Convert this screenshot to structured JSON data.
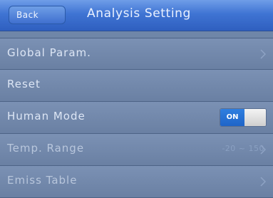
{
  "header": {
    "back_label": "Back",
    "title": "Analysis Setting"
  },
  "rows": [
    {
      "label": "Global Param.",
      "value": "",
      "control": "chevron"
    },
    {
      "label": "Reset",
      "value": "",
      "control": "none"
    },
    {
      "label": "Human Mode",
      "value": "",
      "control": "toggle",
      "toggle_label": "ON",
      "toggle_state": "on"
    },
    {
      "label": "Temp. Range",
      "value": "-20 ~ 150",
      "control": "chevron"
    },
    {
      "label": "Emiss Table",
      "value": "",
      "control": "chevron"
    }
  ],
  "colors": {
    "header_blue": "#3f74d3",
    "row_bg": "#7389ac",
    "toggle_on": "#1f6fd6"
  },
  "icons": {
    "chevron": "chevron-right-icon"
  }
}
